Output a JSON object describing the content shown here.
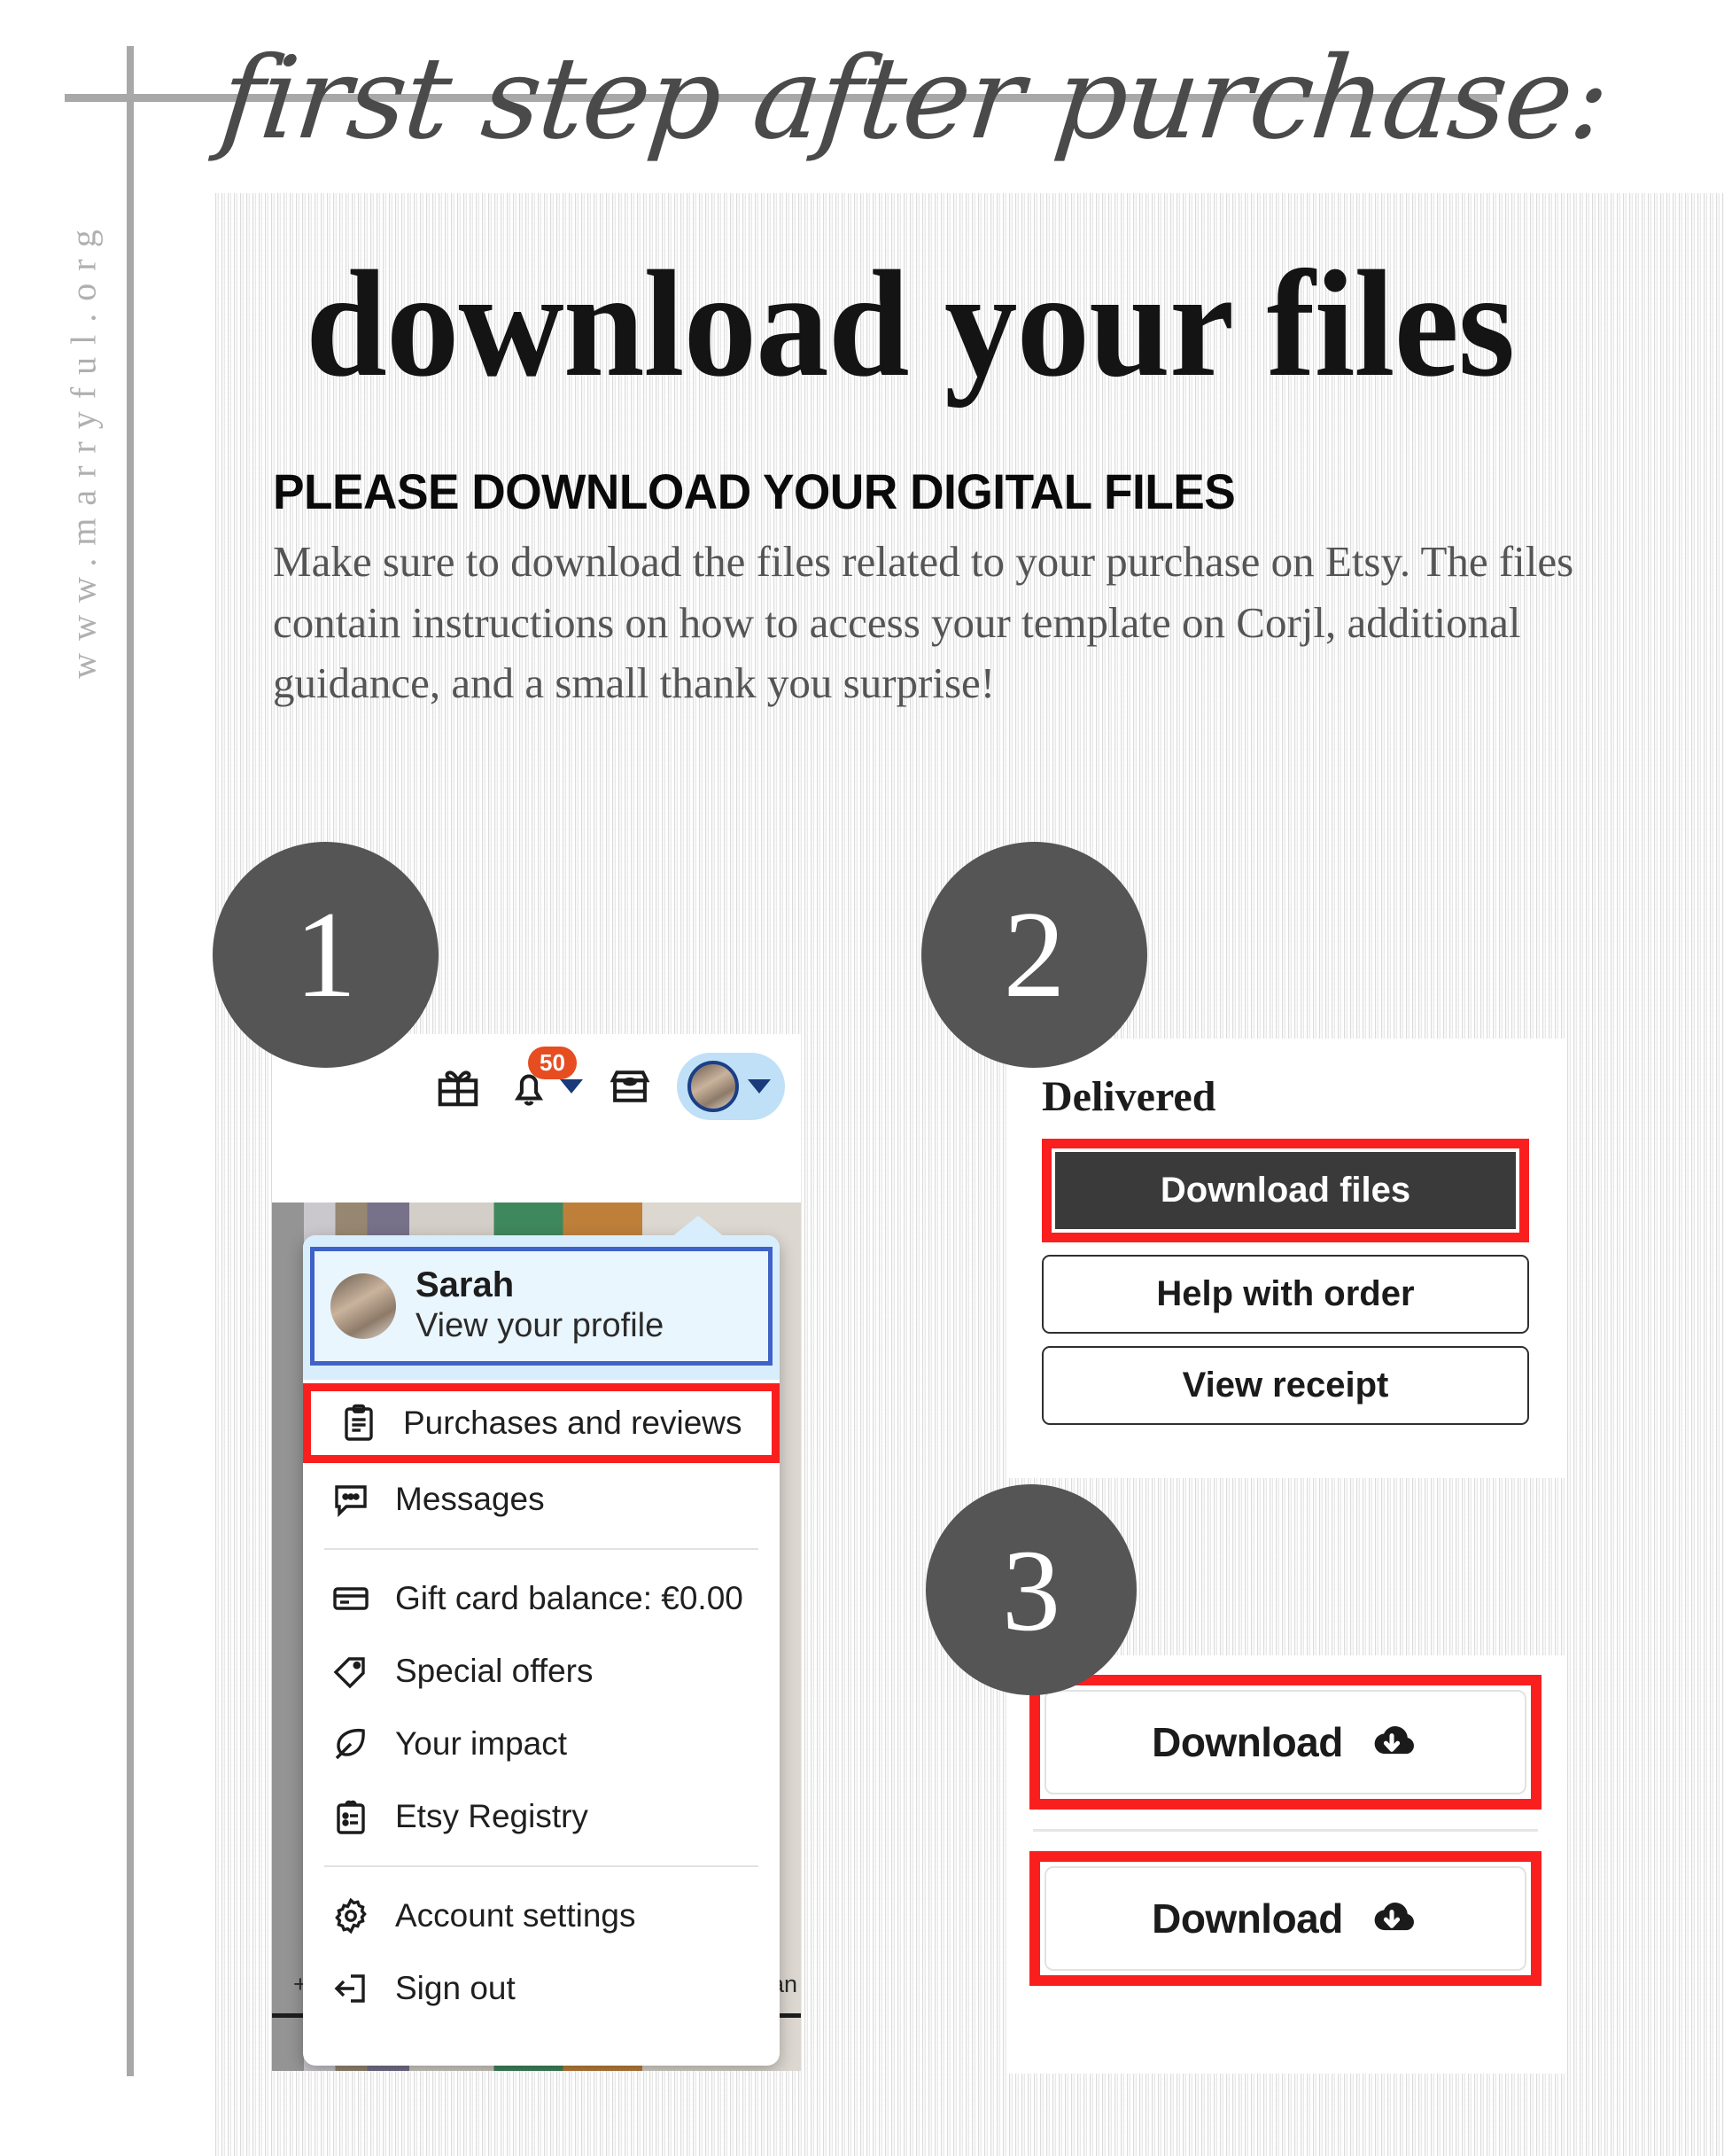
{
  "side_url": "www.marryful.org",
  "header": {
    "script_line": "first step after purchase:",
    "main_title": "download your files"
  },
  "intro": {
    "heading": "PLEASE DOWNLOAD YOUR DIGITAL FILES",
    "paragraph": "Make sure to download the files related to your purchase on Etsy. The files contain instructions on how to access your template on Corjl, additional guidance, and a small thank you surprise!"
  },
  "steps": {
    "one": "1",
    "two": "2",
    "three": "3"
  },
  "step1": {
    "etsy_header": {
      "gift_icon": "gift-icon",
      "bell_icon": "bell-icon",
      "bell_badge": "50",
      "shop_icon": "shop-icon",
      "avatar": "user-avatar"
    },
    "profile": {
      "name": "Sarah",
      "subtitle": "View your profile"
    },
    "menu_items": [
      {
        "label": "Purchases and reviews",
        "icon": "clipboard-icon",
        "highlighted": true
      },
      {
        "label": "Messages",
        "icon": "message-bubble-icon",
        "highlighted": false
      },
      {
        "label": "Gift card balance: €0.00",
        "icon": "credit-card-icon",
        "highlighted": false
      },
      {
        "label": "Special offers",
        "icon": "price-tag-icon",
        "highlighted": false
      },
      {
        "label": "Your impact",
        "icon": "leaf-icon",
        "highlighted": false
      },
      {
        "label": "Etsy Registry",
        "icon": "registry-icon",
        "highlighted": false
      },
      {
        "label": "Account settings",
        "icon": "gear-icon",
        "highlighted": false
      },
      {
        "label": "Sign out",
        "icon": "sign-out-icon",
        "highlighted": false
      }
    ],
    "background_text_left": "+ m",
    "background_text_right": "an"
  },
  "step2": {
    "status_label": "Delivered",
    "primary_button": "Download files",
    "secondary_buttons": [
      "Help with order",
      "View receipt"
    ]
  },
  "step3": {
    "buttons": [
      {
        "label": "Download",
        "icon": "cloud-download-icon"
      },
      {
        "label": "Download",
        "icon": "cloud-download-icon"
      }
    ]
  },
  "colors": {
    "badge_gray": "#555555",
    "highlight_red": "#fa1f1f",
    "etsy_orange": "#e64d21",
    "profile_blue": "#3f62c9",
    "pill_blue": "#bfe0f7",
    "dark_button": "#3a3a3a",
    "rule_gray": "#a8a8a8"
  }
}
